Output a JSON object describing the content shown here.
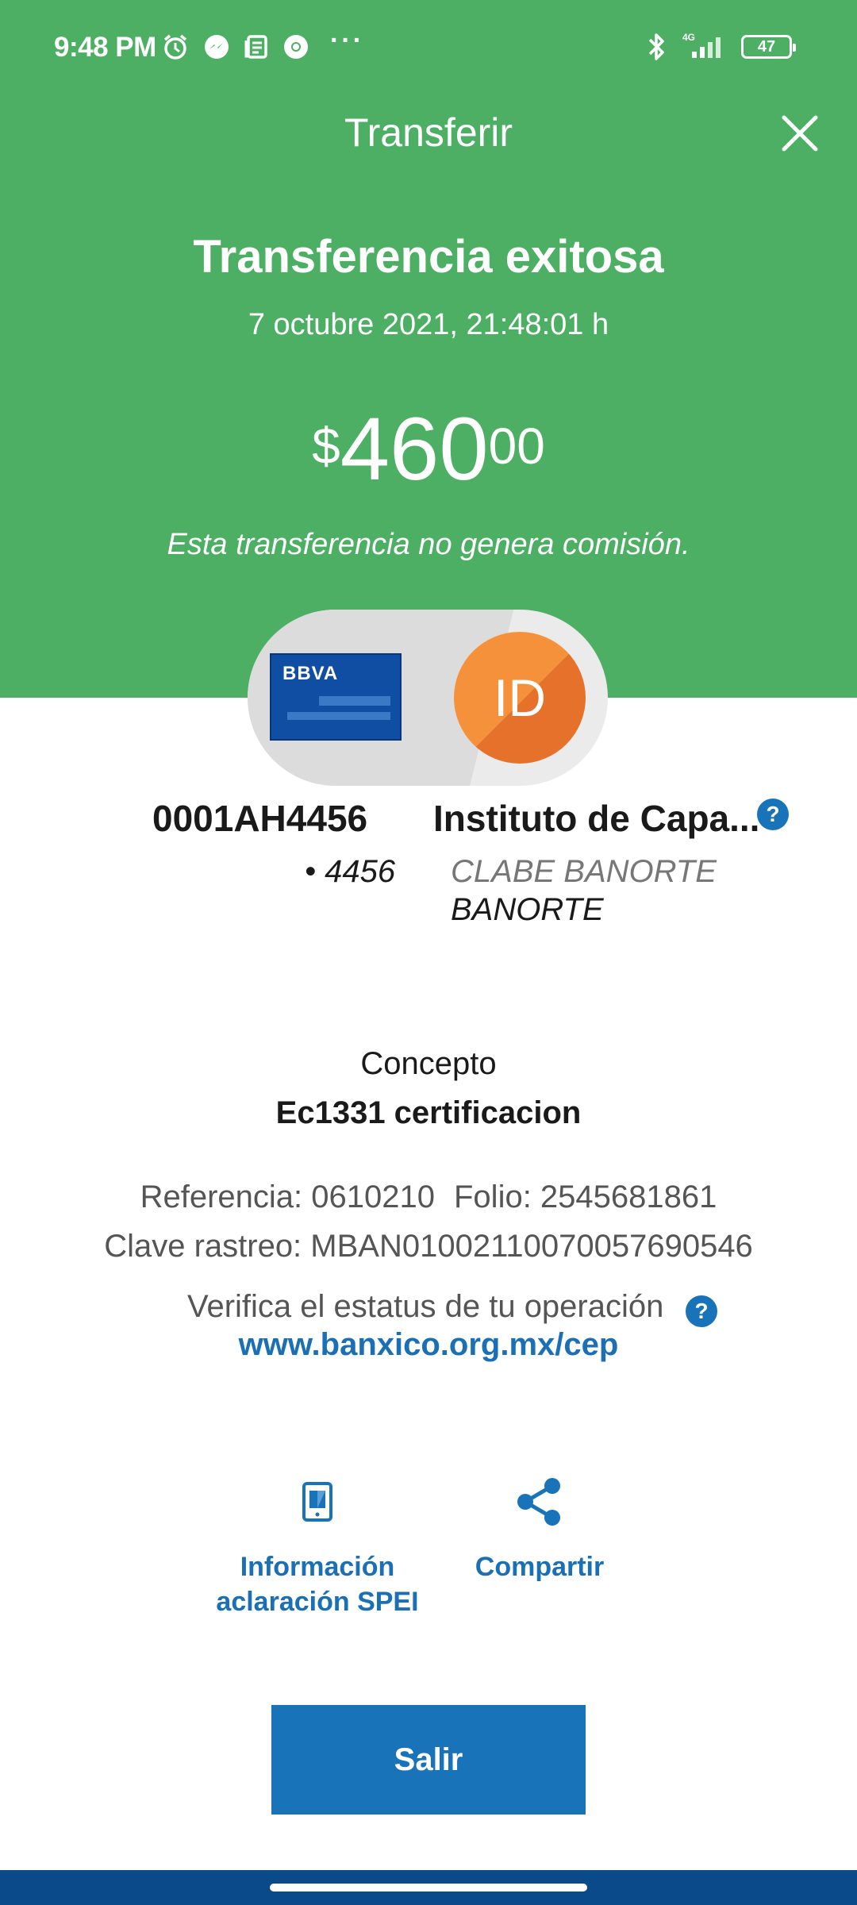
{
  "status_bar": {
    "time": "9:48 PM",
    "battery": "47",
    "network": "4G",
    "icons": [
      "alarm-icon",
      "messenger-icon",
      "news-icon",
      "chrome-icon",
      "more-icon",
      "bluetooth-icon",
      "signal-icon",
      "battery-icon"
    ]
  },
  "header": {
    "title": "Transferir"
  },
  "result": {
    "title": "Transferencia exitosa",
    "date": "7 octubre 2021, 21:48:01 h",
    "amount_currency": "$",
    "amount_integer": "460",
    "amount_decimals": "00",
    "commission_note": "Esta transferencia no genera comisión."
  },
  "origin": {
    "bank_logo": "BBVA",
    "account_name": "0001AH4456",
    "last4": "• 4456"
  },
  "destination": {
    "initials": "ID",
    "name": "Instituto de Capa...",
    "type": "CLABE BANORTE",
    "bank": "BANORTE"
  },
  "concept": {
    "label": "Concepto",
    "value": "Ec1331 certificacion"
  },
  "details": {
    "reference": "Referencia: 0610210",
    "folio": "Folio: 2545681861",
    "tracking_key": "Clave rastreo: MBAN01002110070057690546",
    "verify_text": "Verifica el estatus de tu operación",
    "verify_link": "www.banxico.org.mx/cep"
  },
  "actions": {
    "info_line1": "Información",
    "info_line2": "aclaración SPEI",
    "share": "Compartir"
  },
  "exit_button": "Salir",
  "colors": {
    "success_green": "#4daf63",
    "primary_blue": "#1973b8",
    "avatar_orange": "#f5913b",
    "nav_blue": "#0b4a8a"
  }
}
